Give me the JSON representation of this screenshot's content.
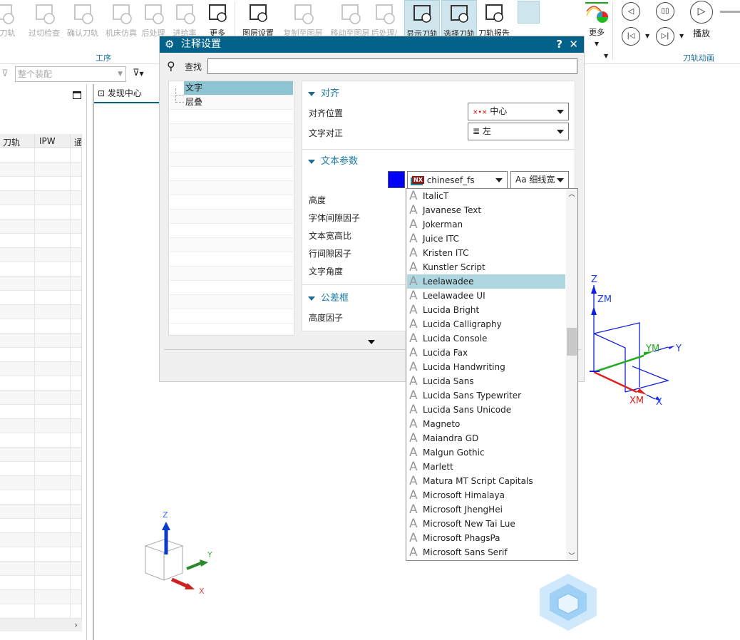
{
  "ribbon": {
    "buttons": [
      {
        "label": "成刀轨",
        "icon": "generate-toolpath-icon",
        "disabled": true
      },
      {
        "label": "过切检查",
        "icon": "gouge-check-icon",
        "disabled": true
      },
      {
        "label": "确认刀轨",
        "icon": "verify-toolpath-icon",
        "disabled": true
      },
      {
        "label": "机床仿真",
        "icon": "machine-simulation-icon",
        "disabled": true
      },
      {
        "label": "后处理",
        "icon": "postprocess-icon",
        "disabled": true
      },
      {
        "label": "进给率",
        "icon": "feedrate-icon",
        "disabled": true
      },
      {
        "label": "更多",
        "icon": "more-tools-icon",
        "disabled": false
      },
      {
        "label": "图层设置",
        "icon": "layer-settings-icon",
        "disabled": false
      },
      {
        "label": "复制至图层",
        "icon": "copy-to-layer-icon",
        "disabled": true
      },
      {
        "label": "移动至图层",
        "icon": "move-to-layer-icon",
        "disabled": true
      },
      {
        "label": "后处理/",
        "icon": "postprocess-icon",
        "disabled": true
      },
      {
        "label": "显示刀轨",
        "icon": "show-toolpath-icon",
        "selected": true
      },
      {
        "label": "选择刀轨",
        "icon": "select-toolpath-icon",
        "selected": true
      },
      {
        "label": "刀轨报告",
        "icon": "toolpath-report-icon",
        "disabled": false
      }
    ],
    "more_label": "更多",
    "play_label": "播放",
    "group_operation": "工序",
    "group_animation": "刀轨动画"
  },
  "filter": {
    "value": "整个装配"
  },
  "left_table": {
    "columns": [
      "刀轨",
      "IPW",
      "通"
    ]
  },
  "tab": {
    "label": "发现中心"
  },
  "dialog": {
    "title": "注释设置",
    "help": "?",
    "close": "✕",
    "search_label": "查找",
    "search_value": "",
    "tree": [
      "文字",
      "层叠"
    ],
    "sections": {
      "align": {
        "title": "对齐",
        "position_label": "对齐位置",
        "position_value": "中心",
        "justify_label": "文字对正",
        "justify_value": "左"
      },
      "text": {
        "title": "文本参数",
        "color": "#0000ff",
        "font_value": "chinesef_fs",
        "font_badge": "NX",
        "width_value": "Aa 细线宽",
        "labels": [
          "高度",
          "字体间隙因子",
          "文本宽高比",
          "行间隙因子",
          "文字角度"
        ]
      },
      "tolerance": {
        "title": "公差框",
        "height_factor_label": "高度因子"
      }
    },
    "font_list": {
      "selected": "Leelawadee",
      "items": [
        "ItalicT",
        "Javanese Text",
        "Jokerman",
        "Juice ITC",
        "Kristen ITC",
        "Kunstler Script",
        "Leelawadee",
        "Leelawadee UI",
        "Lucida Bright",
        "Lucida Calligraphy",
        "Lucida Console",
        "Lucida Fax",
        "Lucida Handwriting",
        "Lucida Sans",
        "Lucida Sans Typewriter",
        "Lucida Sans Unicode",
        "Magneto",
        "Maiandra GD",
        "Malgun Gothic",
        "Marlett",
        "Matura MT Script Capitals",
        "Microsoft Himalaya",
        "Microsoft JhengHei",
        "Microsoft New Tai Lue",
        "Microsoft PhagsPa",
        "Microsoft Sans Serif"
      ]
    }
  },
  "viewport": {
    "axes": {
      "z": "Z",
      "zm": "ZM",
      "y": "Y",
      "ym": "YM",
      "x": "X",
      "xm": "XM"
    },
    "triad": {
      "z": "Z",
      "y": "Y",
      "x": "X"
    }
  },
  "colors": {
    "accent": "#03628a",
    "selection": "#add6e1",
    "tree_selection": "#8cc4d2",
    "section_title": "#1a7aa0"
  }
}
